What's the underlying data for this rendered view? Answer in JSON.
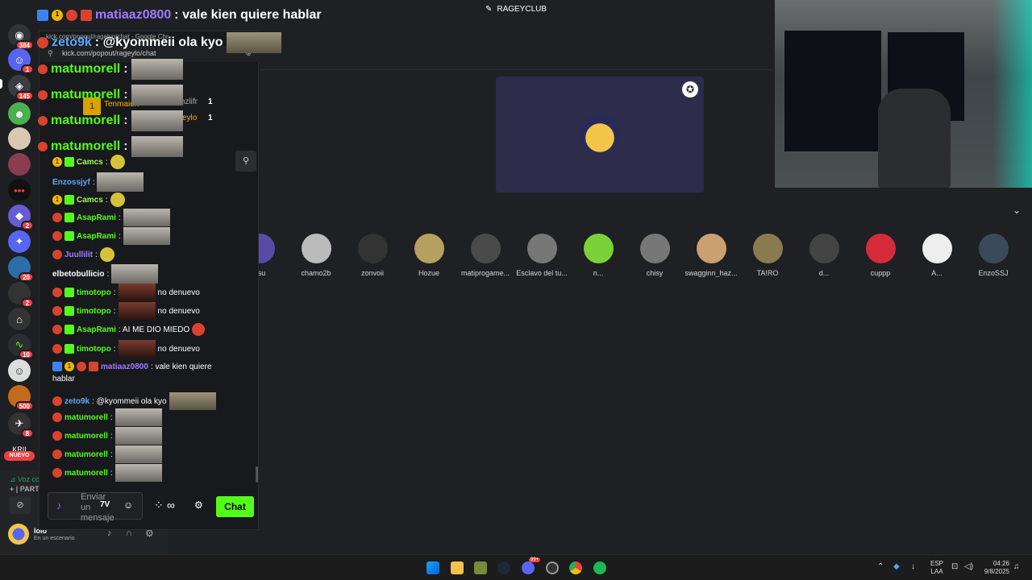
{
  "stage": {
    "title": "RAGEYCLUB"
  },
  "discord": {
    "voice_label": "Voz co",
    "party_label": "+ | PART",
    "user_name": "lolo",
    "user_status": "En un escenario",
    "new_label": "NUEVO",
    "badges": [
      "384",
      "1",
      "145",
      "2",
      "20",
      "2",
      "10",
      "500",
      "8"
    ]
  },
  "overlay": {
    "line1_user": "matiaaz0800",
    "line1_text": ": vale kien quiere hablar",
    "line2_user": "zeto9k",
    "line2_text": ": @kyommeii ola kyo",
    "tab_title": "kick.com/popout/ragelyo/chat - Google Chr",
    "bg_user1": "Tenmaion",
    "bg_user2": "frtnzlifr",
    "bg_user3": "eylo",
    "bg_count1": "1",
    "bg_count2": "1"
  },
  "chat": {
    "url": "kick.com/popout/rageylo/chat",
    "messages": [
      {
        "user": "matumorell",
        "text": ":"
      },
      {
        "user": "matumorell",
        "text": ":"
      },
      {
        "user": "matumorell",
        "text": ":"
      },
      {
        "user": "matumorell",
        "text": ":"
      },
      {
        "user": "Camcs",
        "text": ":"
      },
      {
        "user": "Enzossjyf",
        "text": ":"
      },
      {
        "user": "Camcs",
        "text": ":"
      },
      {
        "user": "AsapRami",
        "text": ":"
      },
      {
        "user": "AsapRami",
        "text": ":"
      },
      {
        "user": "Juullilit",
        "text": ":"
      },
      {
        "user": "elbetobullicio",
        "text": ":"
      },
      {
        "user": "timotopo",
        "text": ":",
        "extra": "no denuevo"
      },
      {
        "user": "timotopo",
        "text": ":",
        "extra": "no denuevo"
      },
      {
        "user": "AsapRami",
        "text": ": AI ME DIO MIEDO"
      },
      {
        "user": "timotopo",
        "text": ":",
        "extra": "no denuevo"
      },
      {
        "user": "matiaaz0800",
        "text": ": vale kien quiere",
        "text2": "hablar"
      },
      {
        "user": "zeto9k",
        "text": ": @kyommeii ola kyo"
      },
      {
        "user": "matumorell",
        "text": ":"
      },
      {
        "user": "matumorell",
        "text": ":"
      },
      {
        "user": "matumorell",
        "text": ":"
      },
      {
        "user": "matumorell",
        "text": ":"
      }
    ],
    "input_placeholder": "Enviar un mensaje",
    "send_label": "Chat"
  },
  "participants": [
    {
      "name": "asu"
    },
    {
      "name": "chamo2b"
    },
    {
      "name": "zonvoii"
    },
    {
      "name": "Hozue"
    },
    {
      "name": "matiprogame..."
    },
    {
      "name": "Esclavo del tu..."
    },
    {
      "name": "n..."
    },
    {
      "name": "chisy"
    },
    {
      "name": "swagginn_haz..."
    },
    {
      "name": "TA!RO"
    },
    {
      "name": "d..."
    },
    {
      "name": "cuppp"
    },
    {
      "name": "A..."
    },
    {
      "name": "EnzoSSJ"
    }
  ],
  "taskbar": {
    "lang1": "ESP",
    "lang2": "LAA",
    "time": "04:26",
    "date": "9/8/2025",
    "notif_count": "99+"
  },
  "colors": {
    "kick_green": "#53fc18",
    "discord_red": "#f23f43",
    "stage_purple": "#2d2c4b"
  }
}
